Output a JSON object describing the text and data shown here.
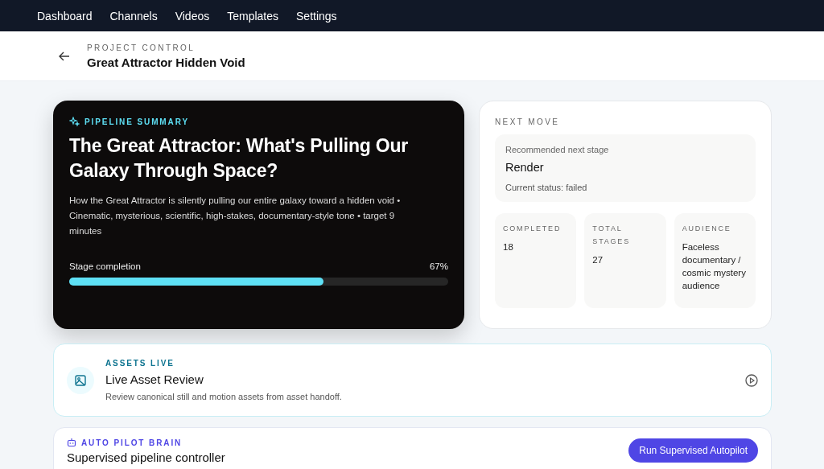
{
  "nav": {
    "items": [
      {
        "label": "Dashboard"
      },
      {
        "label": "Channels"
      },
      {
        "label": "Videos"
      },
      {
        "label": "Templates"
      },
      {
        "label": "Settings"
      }
    ]
  },
  "header": {
    "eyebrow": "PROJECT CONTROL",
    "title": "Great Attractor Hidden Void"
  },
  "summary": {
    "eyebrow": "PIPELINE SUMMARY",
    "title": "The Great Attractor: What's Pulling Our Galaxy Through Space?",
    "description": "How the Great Attractor is silently pulling our entire galaxy toward a hidden void • Cinematic, mysterious, scientific, high-stakes, documentary-style tone • target 9 minutes",
    "progress_label": "Stage completion",
    "progress_reading": "67%",
    "level": 0.67
  },
  "next_move": {
    "eyebrow": "NEXT MOVE",
    "recommend_label": "Recommended next stage",
    "stage": "Render",
    "status": "Current status: failed",
    "stats": [
      {
        "label": "COMPLETED",
        "value": "18"
      },
      {
        "label": "TOTAL STAGES",
        "value": "27"
      },
      {
        "label": "AUDIENCE",
        "value": "Faceless documentary / cosmic mystery audience"
      }
    ]
  },
  "assets": {
    "eyebrow": "ASSETS LIVE",
    "title": "Live Asset Review",
    "description": "Review canonical still and motion assets from asset handoff."
  },
  "autopilot": {
    "eyebrow": "AUTO PILOT BRAIN",
    "title": "Supervised pipeline controller",
    "button": "Run Supervised Autopilot"
  }
}
